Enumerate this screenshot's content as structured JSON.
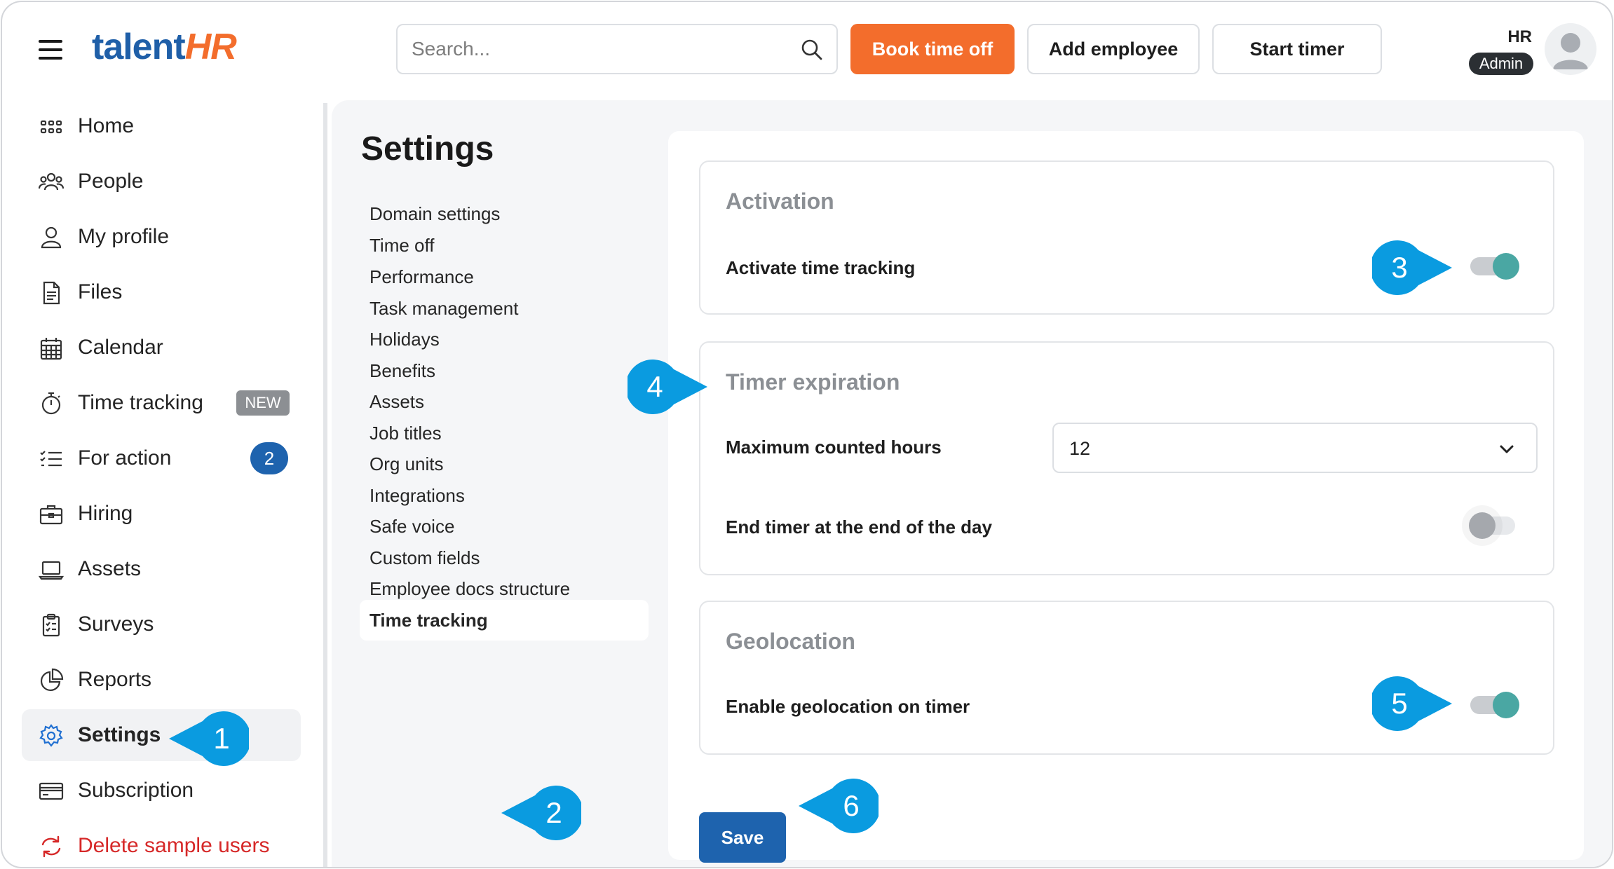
{
  "app": {
    "logo_part1": "talent",
    "logo_part2": "HR"
  },
  "header": {
    "search_placeholder": "Search...",
    "book_time_off": "Book time off",
    "add_employee": "Add employee",
    "start_timer": "Start timer",
    "user_name": "HR",
    "user_role": "Admin"
  },
  "sidebar": {
    "items": [
      {
        "label": "Home",
        "icon": "grid-icon"
      },
      {
        "label": "People",
        "icon": "people-icon"
      },
      {
        "label": "My profile",
        "icon": "user-icon"
      },
      {
        "label": "Files",
        "icon": "file-icon"
      },
      {
        "label": "Calendar",
        "icon": "calendar-icon"
      },
      {
        "label": "Time tracking",
        "icon": "stopwatch-icon",
        "badge": "NEW"
      },
      {
        "label": "For action",
        "icon": "checklist-icon",
        "count": "2"
      },
      {
        "label": "Hiring",
        "icon": "briefcase-icon"
      },
      {
        "label": "Assets",
        "icon": "laptop-icon"
      },
      {
        "label": "Surveys",
        "icon": "clipboard-icon"
      },
      {
        "label": "Reports",
        "icon": "pie-chart-icon"
      },
      {
        "label": "Settings",
        "icon": "gear-icon",
        "active": true
      },
      {
        "label": "Subscription",
        "icon": "credit-card-icon"
      },
      {
        "label": "Delete sample users",
        "icon": "refresh-icon"
      }
    ]
  },
  "settings": {
    "title": "Settings",
    "menu": [
      "Domain settings",
      "Time off",
      "Performance",
      "Task management",
      "Holidays",
      "Benefits",
      "Assets",
      "Job titles",
      "Org units",
      "Integrations",
      "Safe voice",
      "Custom fields",
      "Employee docs structure",
      "Time tracking"
    ],
    "active_menu": "Time tracking"
  },
  "time_tracking": {
    "activation": {
      "title": "Activation",
      "activate_label": "Activate time tracking",
      "activate_on": true
    },
    "timer_expiration": {
      "title": "Timer expiration",
      "max_hours_label": "Maximum counted hours",
      "max_hours_value": "12",
      "end_of_day_label": "End timer at the end of the day",
      "end_of_day_on": false
    },
    "geolocation": {
      "title": "Geolocation",
      "enable_label": "Enable geolocation on timer",
      "enable_on": true
    },
    "save_label": "Save"
  },
  "callouts": [
    "1",
    "2",
    "3",
    "4",
    "5",
    "6"
  ],
  "colors": {
    "brand_blue": "#1f5fa8",
    "brand_orange": "#f36d2c",
    "callout_blue": "#0a9be0",
    "toggle_on": "#4aa7a3",
    "delete_red": "#d62828"
  }
}
